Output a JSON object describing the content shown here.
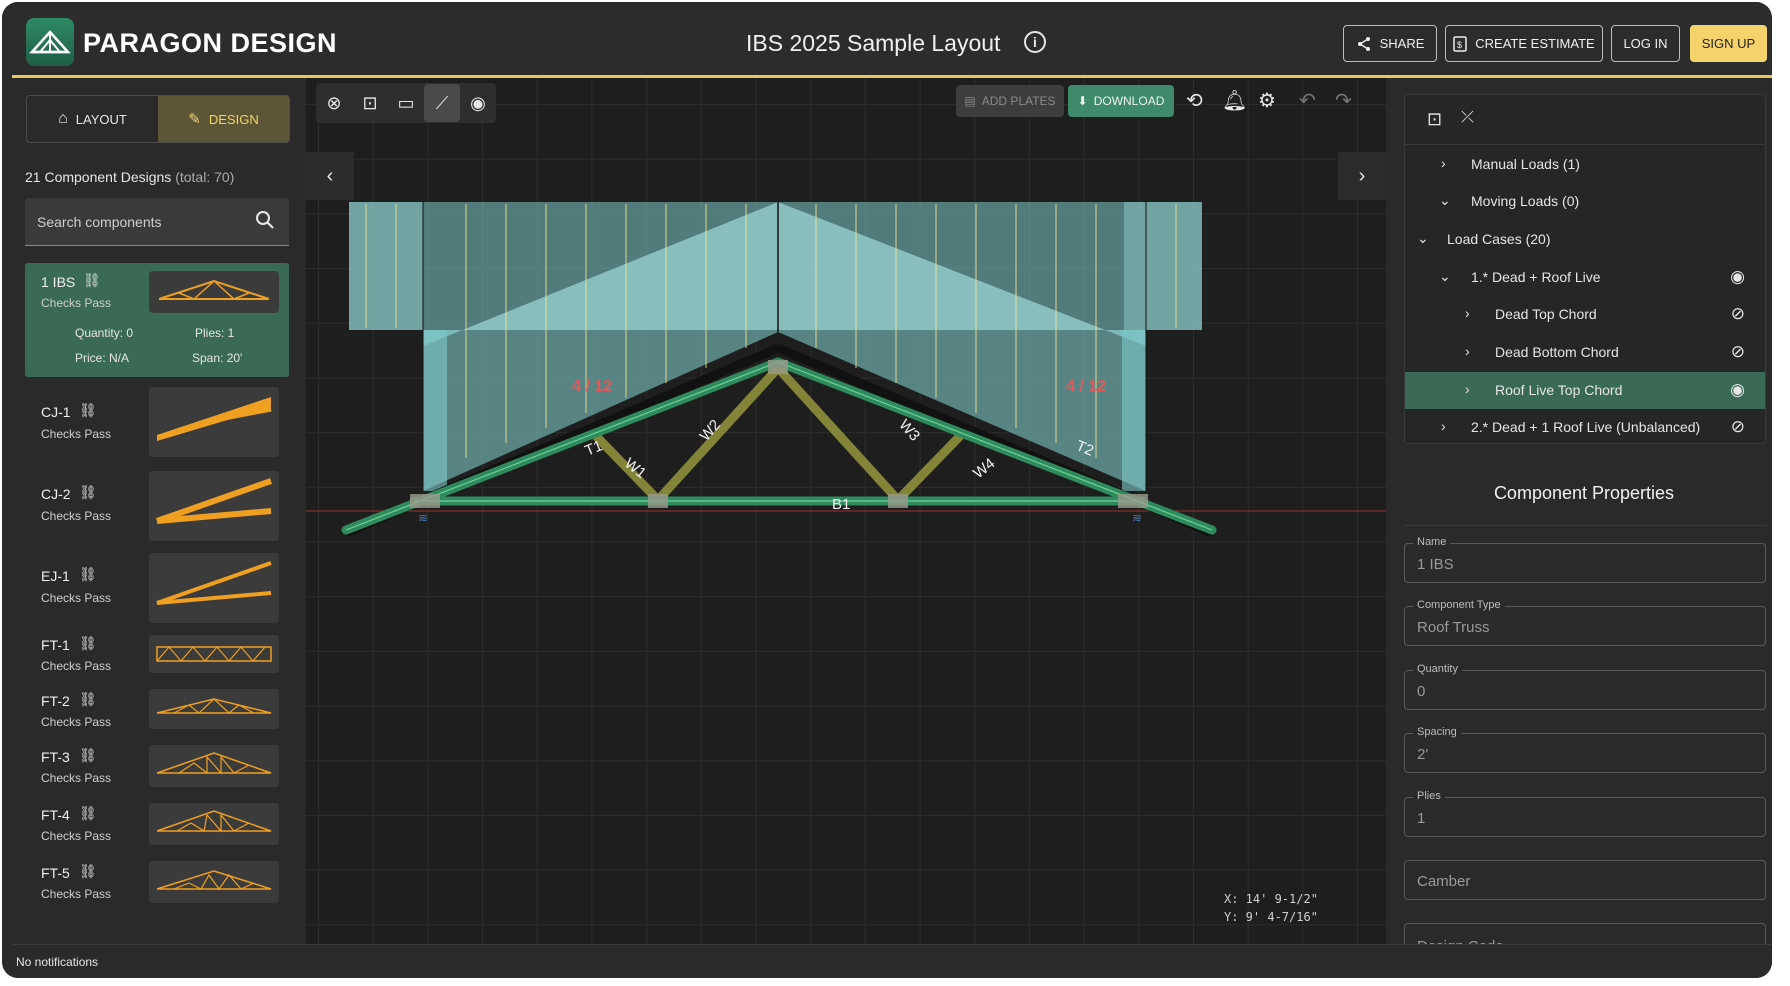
{
  "app": {
    "brand": "PARAGON DESIGN",
    "document_title": "IBS 2025 Sample Layout",
    "colors": {
      "accent_gold": "#f6d36a",
      "green": "#3f8a6a",
      "panel": "#2a2a2a",
      "canvas": "#1e1e1e"
    }
  },
  "header": {
    "share": "SHARE",
    "create_estimate": "CREATE ESTIMATE",
    "log_in": "LOG IN",
    "sign_up": "SIGN UP"
  },
  "left": {
    "tabs": [
      {
        "label": "LAYOUT",
        "icon": "house-icon"
      },
      {
        "label": "DESIGN",
        "icon": "design-pencil-icon"
      }
    ],
    "count_label": "21 Component Designs",
    "count_total": "(total: 70)",
    "search_placeholder": "Search components",
    "components": [
      {
        "name": "1 IBS",
        "status": "Checks Pass",
        "quantity": "Quantity: 0",
        "plies": "Plies: 1",
        "price": "Price: N/A",
        "span": "Span: 20'"
      },
      {
        "name": "CJ-1",
        "status": "Checks Pass"
      },
      {
        "name": "CJ-2",
        "status": "Checks Pass"
      },
      {
        "name": "EJ-1",
        "status": "Checks Pass"
      },
      {
        "name": "FT-1",
        "status": "Checks Pass"
      },
      {
        "name": "FT-2",
        "status": "Checks Pass"
      },
      {
        "name": "FT-3",
        "status": "Checks Pass"
      },
      {
        "name": "FT-4",
        "status": "Checks Pass"
      },
      {
        "name": "FT-5",
        "status": "Checks Pass"
      }
    ]
  },
  "canvas": {
    "add_plates": "ADD PLATES",
    "download": "DOWNLOAD",
    "pitch_left": "4 / 12",
    "pitch_right": "4 / 12",
    "members": {
      "t1": "T1",
      "t2": "T2",
      "w1": "W1",
      "w2": "W2",
      "w3": "W3",
      "w4": "W4",
      "b1": "B1"
    },
    "coord_x": "X: 14' 9-1/2\"",
    "coord_y": "Y: 9' 4-7/16\""
  },
  "right": {
    "tree": [
      {
        "label": "Manual Loads (1)",
        "chevron": "right",
        "eye": ""
      },
      {
        "label": "Moving Loads (0)",
        "chevron": "down",
        "eye": ""
      },
      {
        "label": "Load Cases (20)",
        "chevron": "down",
        "eye": ""
      },
      {
        "label": "1.* Dead + Roof Live",
        "chevron": "down",
        "eye": "eye-icon"
      },
      {
        "label": "Dead Top Chord",
        "chevron": "right",
        "eye": "eye-off-icon"
      },
      {
        "label": "Dead Bottom Chord",
        "chevron": "right",
        "eye": "eye-off-icon"
      },
      {
        "label": "Roof Live Top Chord",
        "chevron": "right",
        "eye": "eye-icon"
      },
      {
        "label": "2.* Dead + 1 Roof Live (Unbalanced)",
        "chevron": "right",
        "eye": "eye-off-icon"
      }
    ],
    "properties_title": "Component Properties",
    "fields": [
      {
        "label": "Name",
        "value": "1 IBS"
      },
      {
        "label": "Component Type",
        "value": "Roof Truss"
      },
      {
        "label": "Quantity",
        "value": "0"
      },
      {
        "label": "Spacing",
        "value": "2'"
      },
      {
        "label": "Plies",
        "value": "1"
      },
      {
        "label": "",
        "value": "Camber"
      },
      {
        "label": "",
        "value": "Design Code"
      }
    ]
  },
  "status": {
    "text": "No notifications"
  }
}
